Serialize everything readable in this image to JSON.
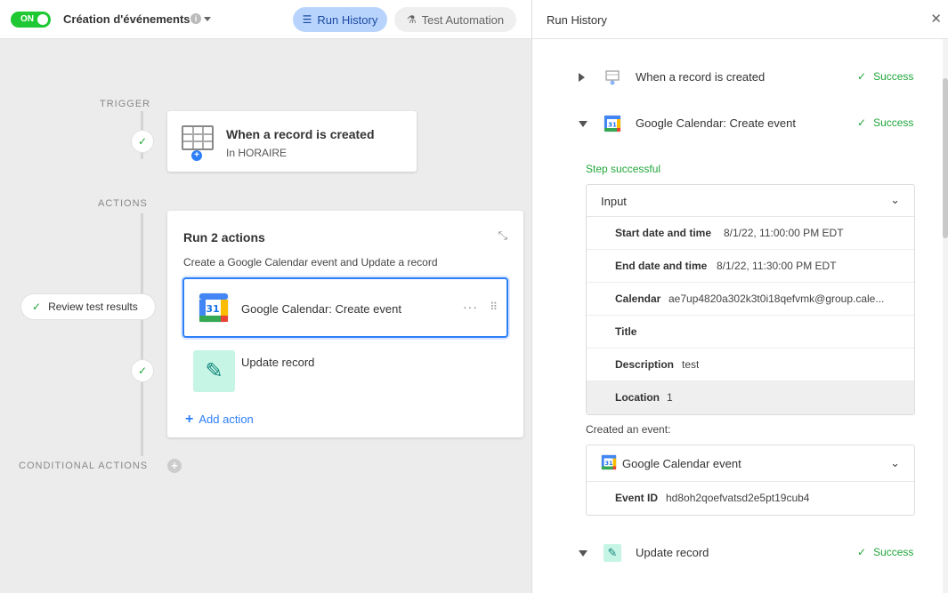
{
  "header": {
    "toggle_label": "ON",
    "automation_title": "Création d'événements",
    "run_history_label": "Run History",
    "test_automation_label": "Test Automation"
  },
  "canvas": {
    "trigger_section": "TRIGGER",
    "actions_section": "ACTIONS",
    "conditional_section": "CONDITIONAL ACTIONS",
    "trigger": {
      "title": "When a record is created",
      "subtitle": "In HORAIRE"
    },
    "actions": {
      "title": "Run 2 actions",
      "subtitle": "Create a Google Calendar event and Update a record",
      "items": [
        {
          "label": "Google Calendar: Create event"
        },
        {
          "label": "Update record"
        }
      ],
      "add_action_label": "Add action"
    },
    "review_label": "Review test results"
  },
  "panel": {
    "title": "Run History",
    "steps": [
      {
        "label": "When a record is created",
        "status": "Success"
      },
      {
        "label": "Google Calendar: Create event",
        "status": "Success"
      },
      {
        "label": "Update record",
        "status": "Success"
      }
    ],
    "step_successful": "Step successful",
    "input": {
      "heading": "Input",
      "fields": [
        {
          "key": "Start date and time",
          "value": "8/1/22, 11:00:00 PM EDT"
        },
        {
          "key": "End date and time",
          "value": "8/1/22, 11:30:00 PM EDT"
        },
        {
          "key": "Calendar",
          "value": "ae7up4820a302k3t0i18qefvmk@group.cale..."
        },
        {
          "key": "Title",
          "value": ""
        },
        {
          "key": "Description",
          "value": "test"
        },
        {
          "key": "Location",
          "value": "1"
        }
      ]
    },
    "created_label": "Created an event:",
    "event": {
      "heading": "Google Calendar event",
      "fields": [
        {
          "key": "Event ID",
          "value": "hd8oh2qoefvatsd2e5pt19cub4"
        }
      ]
    }
  },
  "colors": {
    "accent": "#2d7ff9",
    "success": "#20a63a",
    "toggle_on": "#20c933",
    "run_history_bg": "#b8d4fd"
  }
}
